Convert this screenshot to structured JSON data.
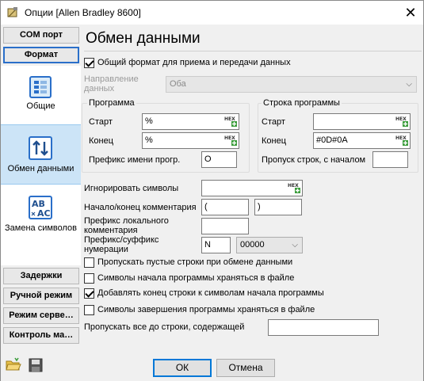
{
  "window": {
    "title": "Опции [Allen Bradley 8600]",
    "close": "✕"
  },
  "nav": {
    "top_buttons": [
      "COM порт",
      "Формат"
    ],
    "items": [
      {
        "label": "Общие"
      },
      {
        "label": "Обмен данными"
      },
      {
        "label": "Замена символов"
      }
    ],
    "bottom_buttons": [
      "Задержки",
      "Ручной режим",
      "Режим серве…",
      "Контроль ма…"
    ]
  },
  "main": {
    "heading": "Обмен данными",
    "common_format": {
      "label": "Общий формат для приема и передачи данных",
      "checked": true
    },
    "direction": {
      "label": "Направление данных",
      "value": "Оба"
    },
    "program_group": {
      "title": "Программа",
      "start_label": "Старт",
      "start_value": "%",
      "end_label": "Конец",
      "end_value": "%",
      "prefix_label": "Префикс имени прогр.",
      "prefix_value": "O"
    },
    "line_group": {
      "title": "Строка программы",
      "start_label": "Старт",
      "start_value": "",
      "end_label": "Конец",
      "end_value": "#0D#0A",
      "skip_label": "Пропуск строк, с началом",
      "skip_value": ""
    },
    "ignore": {
      "label": "Игнорировать символы",
      "value": ""
    },
    "comment": {
      "label": "Начало/конец комментария",
      "start": "(",
      "end": ")"
    },
    "local_comment": {
      "label": "Префикс локального комментария",
      "value": ""
    },
    "numbering": {
      "label": "Префикс/суффикс нумерации",
      "prefix": "N",
      "format": "00000"
    },
    "checks": [
      {
        "label": "Пропускать пустые строки при обмене данными",
        "checked": false
      },
      {
        "label": "Символы начала программы храняться в файле",
        "checked": false
      },
      {
        "label": "Добавлять конец строки к символам начала программы",
        "checked": true
      },
      {
        "label": "Символы завершения программы храняться в файле",
        "checked": false
      }
    ],
    "skip_until": {
      "label": "Пропускать все до строки, содержащей",
      "value": ""
    }
  },
  "footer": {
    "ok": "ОК",
    "cancel": "Отмена"
  },
  "hex_label": "HEX",
  "icons": [
    "folder-open-icon",
    "save-icon",
    "general-settings-icon",
    "data-exchange-icon",
    "char-replace-icon",
    "hex-input-icon"
  ]
}
